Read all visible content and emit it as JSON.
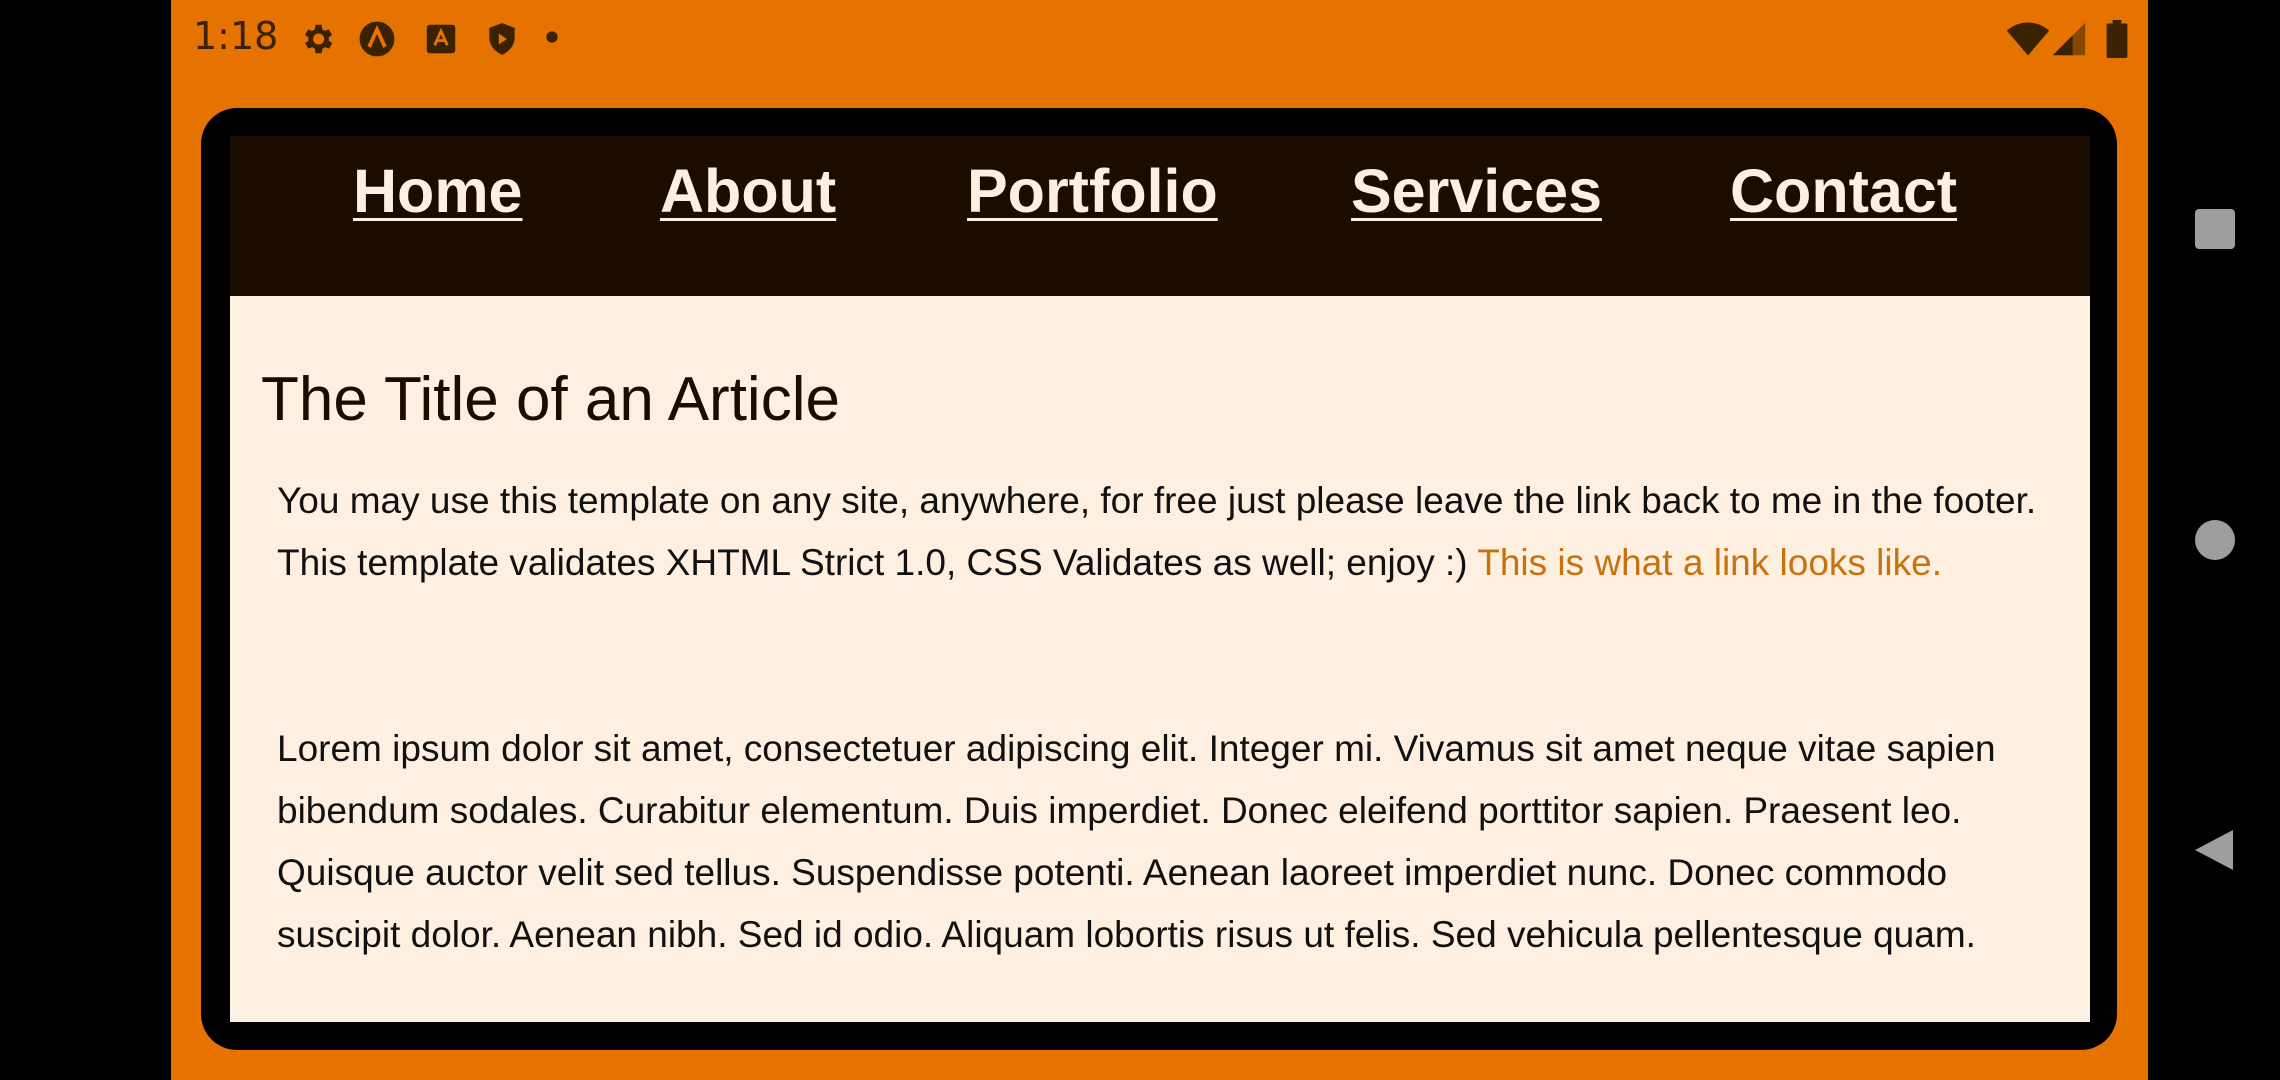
{
  "status_bar": {
    "time": "1:18",
    "icons": [
      "gear-icon",
      "app-a-icon",
      "store-icon",
      "shield-play-icon",
      "dot-icon",
      "wifi-icon",
      "signal-icon",
      "battery-icon"
    ]
  },
  "nav": {
    "items": [
      {
        "label": "Home"
      },
      {
        "label": "About"
      },
      {
        "label": "Portfolio"
      },
      {
        "label": "Services"
      },
      {
        "label": "Contact"
      }
    ]
  },
  "article": {
    "title": "The Title of an Article",
    "paragraph1_text": "You may use this template on any site, anywhere, for free just please leave the link back to me in the footer. This template validates XHTML Strict 1.0, CSS Validates as well; enjoy :) ",
    "paragraph1_link": "This is what a link looks like.",
    "paragraph2_text": "Lorem ipsum dolor sit amet, consectetuer adipiscing elit. Integer mi. Vivamus sit amet neque vitae sapien bibendum sodales. Curabitur elementum. Duis imperdiet. Donec eleifend porttitor sapien. Praesent leo. Quisque auctor velit sed tellus. Suspendisse potenti. Aenean laoreet imperdiet nunc. Donec commodo suscipit dolor. Aenean nibh. Sed id odio. Aliquam lobortis risus ut felis. Sed vehicula pellentesque quam."
  },
  "colors": {
    "app_background": "#E67300",
    "nav_background": "#1A0D00",
    "page_background": "#FDF0E1",
    "link": "#C8720E"
  },
  "system_nav": {
    "icons": [
      "recents-icon",
      "home-icon",
      "back-icon"
    ]
  }
}
